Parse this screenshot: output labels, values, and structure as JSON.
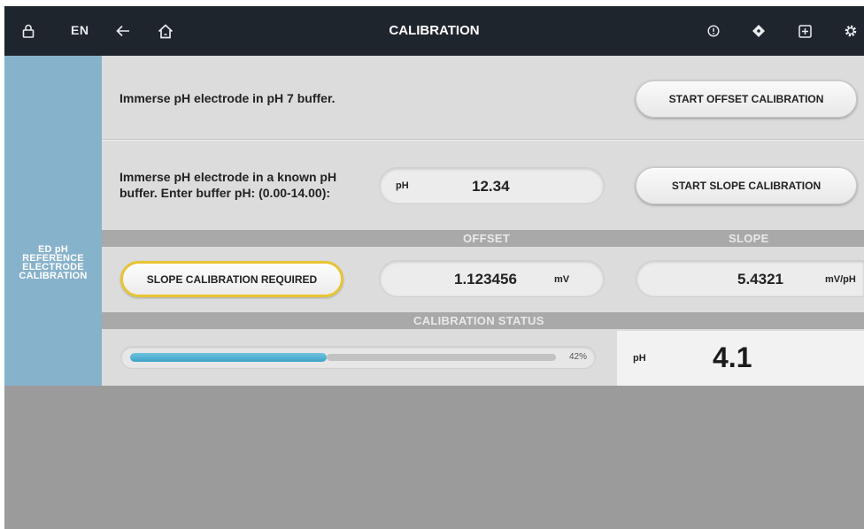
{
  "topbar": {
    "lang": "EN",
    "title": "CALIBRATION",
    "icons": [
      "lock-icon",
      "back-arrow-icon",
      "home-icon",
      "info-icon",
      "diamond-icon",
      "add-box-icon",
      "settings-icon"
    ]
  },
  "sidebar": {
    "lines": [
      "ED pH",
      "REFERENCE",
      "ELECTRODE",
      "CALIBRATION"
    ]
  },
  "offset_row": {
    "instruction": "Immerse pH electrode in pH 7 buffer.",
    "button_label": "START OFFSET CALIBRATION"
  },
  "slope_row": {
    "instruction_line1": "Immerse pH electrode in a known pH",
    "instruction_line2": "buffer. Enter buffer pH: (0.00-14.00):",
    "field_unit": "pH",
    "field_value": "12.34",
    "button_label": "START SLOPE CALIBRATION"
  },
  "results_header": {
    "offset": "OFFSET",
    "slope": "SLOPE"
  },
  "results": {
    "status_button": "SLOPE CALIBRATION REQUIRED",
    "offset_value": "1.123456",
    "offset_unit": "mV",
    "slope_value": "5.4321",
    "slope_unit": "mV/pH"
  },
  "status_header": "CALIBRATION STATUS",
  "status": {
    "progress": 42,
    "progress_label": "42%",
    "ph_label": "pH",
    "ph_value": "4.1"
  },
  "colors": {
    "topbar": "#1f252c",
    "sidebar": "#87b2cb",
    "accent_yellow": "#e9c431",
    "progress": "#3ea3c7"
  }
}
